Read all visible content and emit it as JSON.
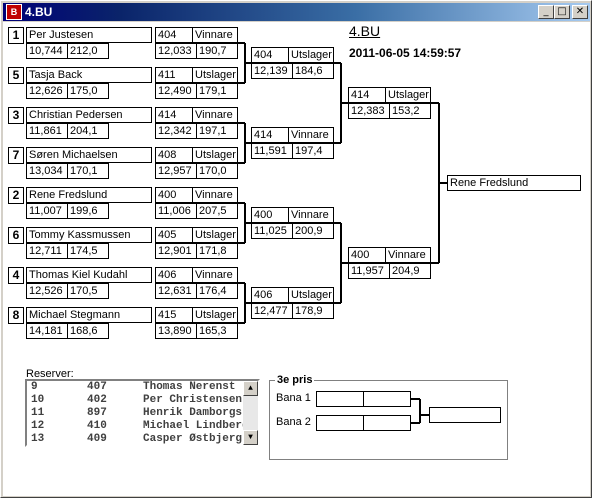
{
  "window": {
    "title": "4.BU",
    "icon_text": "B"
  },
  "event": {
    "name": "4.BU",
    "date": "2011-06-05 14:59:57"
  },
  "round1": [
    {
      "seed": "1",
      "name": "Per Justesen",
      "s1": "10,744",
      "s2": "212,0"
    },
    {
      "seed": "5",
      "name": "Tasja Back",
      "s1": "12,626",
      "s2": "175,0"
    },
    {
      "seed": "3",
      "name": "Christian Pedersen",
      "s1": "11,861",
      "s2": "204,1"
    },
    {
      "seed": "7",
      "name": "Søren Michaelsen",
      "s1": "13,034",
      "s2": "170,1"
    },
    {
      "seed": "2",
      "name": "Rene Fredslund",
      "s1": "11,007",
      "s2": "199,6"
    },
    {
      "seed": "6",
      "name": "Tommy Kassmussen",
      "s1": "12,711",
      "s2": "174,5"
    },
    {
      "seed": "4",
      "name": "Thomas Kiel Kudahl",
      "s1": "12,526",
      "s2": "170,5"
    },
    {
      "seed": "8",
      "name": "Michael Stegmann",
      "s1": "14,181",
      "s2": "168,6"
    }
  ],
  "round1_results": [
    {
      "num": "404",
      "status": "Vinnare",
      "s1": "12,033",
      "s2": "190,7"
    },
    {
      "num": "411",
      "status": "Utslager",
      "s1": "12,490",
      "s2": "179,1"
    },
    {
      "num": "414",
      "status": "Vinnare",
      "s1": "12,342",
      "s2": "197,1"
    },
    {
      "num": "408",
      "status": "Utslager",
      "s1": "12,957",
      "s2": "170,0"
    },
    {
      "num": "400",
      "status": "Vinnare",
      "s1": "11,006",
      "s2": "207,5"
    },
    {
      "num": "405",
      "status": "Utslager",
      "s1": "12,901",
      "s2": "171,8"
    },
    {
      "num": "406",
      "status": "Vinnare",
      "s1": "12,631",
      "s2": "176,4"
    },
    {
      "num": "415",
      "status": "Utslager",
      "s1": "13,890",
      "s2": "165,3"
    }
  ],
  "round2": [
    {
      "num": "404",
      "status": "Utslager",
      "s1": "12,139",
      "s2": "184,6"
    },
    {
      "num": "414",
      "status": "Vinnare",
      "s1": "11,591",
      "s2": "197,4"
    },
    {
      "num": "400",
      "status": "Vinnare",
      "s1": "11,025",
      "s2": "200,9"
    },
    {
      "num": "406",
      "status": "Utslager",
      "s1": "12,477",
      "s2": "178,9"
    }
  ],
  "semis": [
    {
      "num": "414",
      "status": "Utslager",
      "s1": "12,383",
      "s2": "153,2"
    },
    {
      "num": "400",
      "status": "Vinnare",
      "s1": "11,957",
      "s2": "204,9"
    }
  ],
  "winner": "Rene Fredslund",
  "reserves": {
    "label": "Reserver:",
    "rows": [
      {
        "pos": "9",
        "num": "407",
        "name": "Thomas Nerenst"
      },
      {
        "pos": "10",
        "num": "402",
        "name": "Per Christensen"
      },
      {
        "pos": "11",
        "num": "897",
        "name": "Henrik Damborgs"
      },
      {
        "pos": "12",
        "num": "410",
        "name": "Michael Lindberg"
      },
      {
        "pos": "13",
        "num": "409",
        "name": "Casper Østbjerg H"
      }
    ]
  },
  "third_place": {
    "title": "3e pris",
    "lane1": "Bana 1",
    "lane2": "Bana 2"
  }
}
